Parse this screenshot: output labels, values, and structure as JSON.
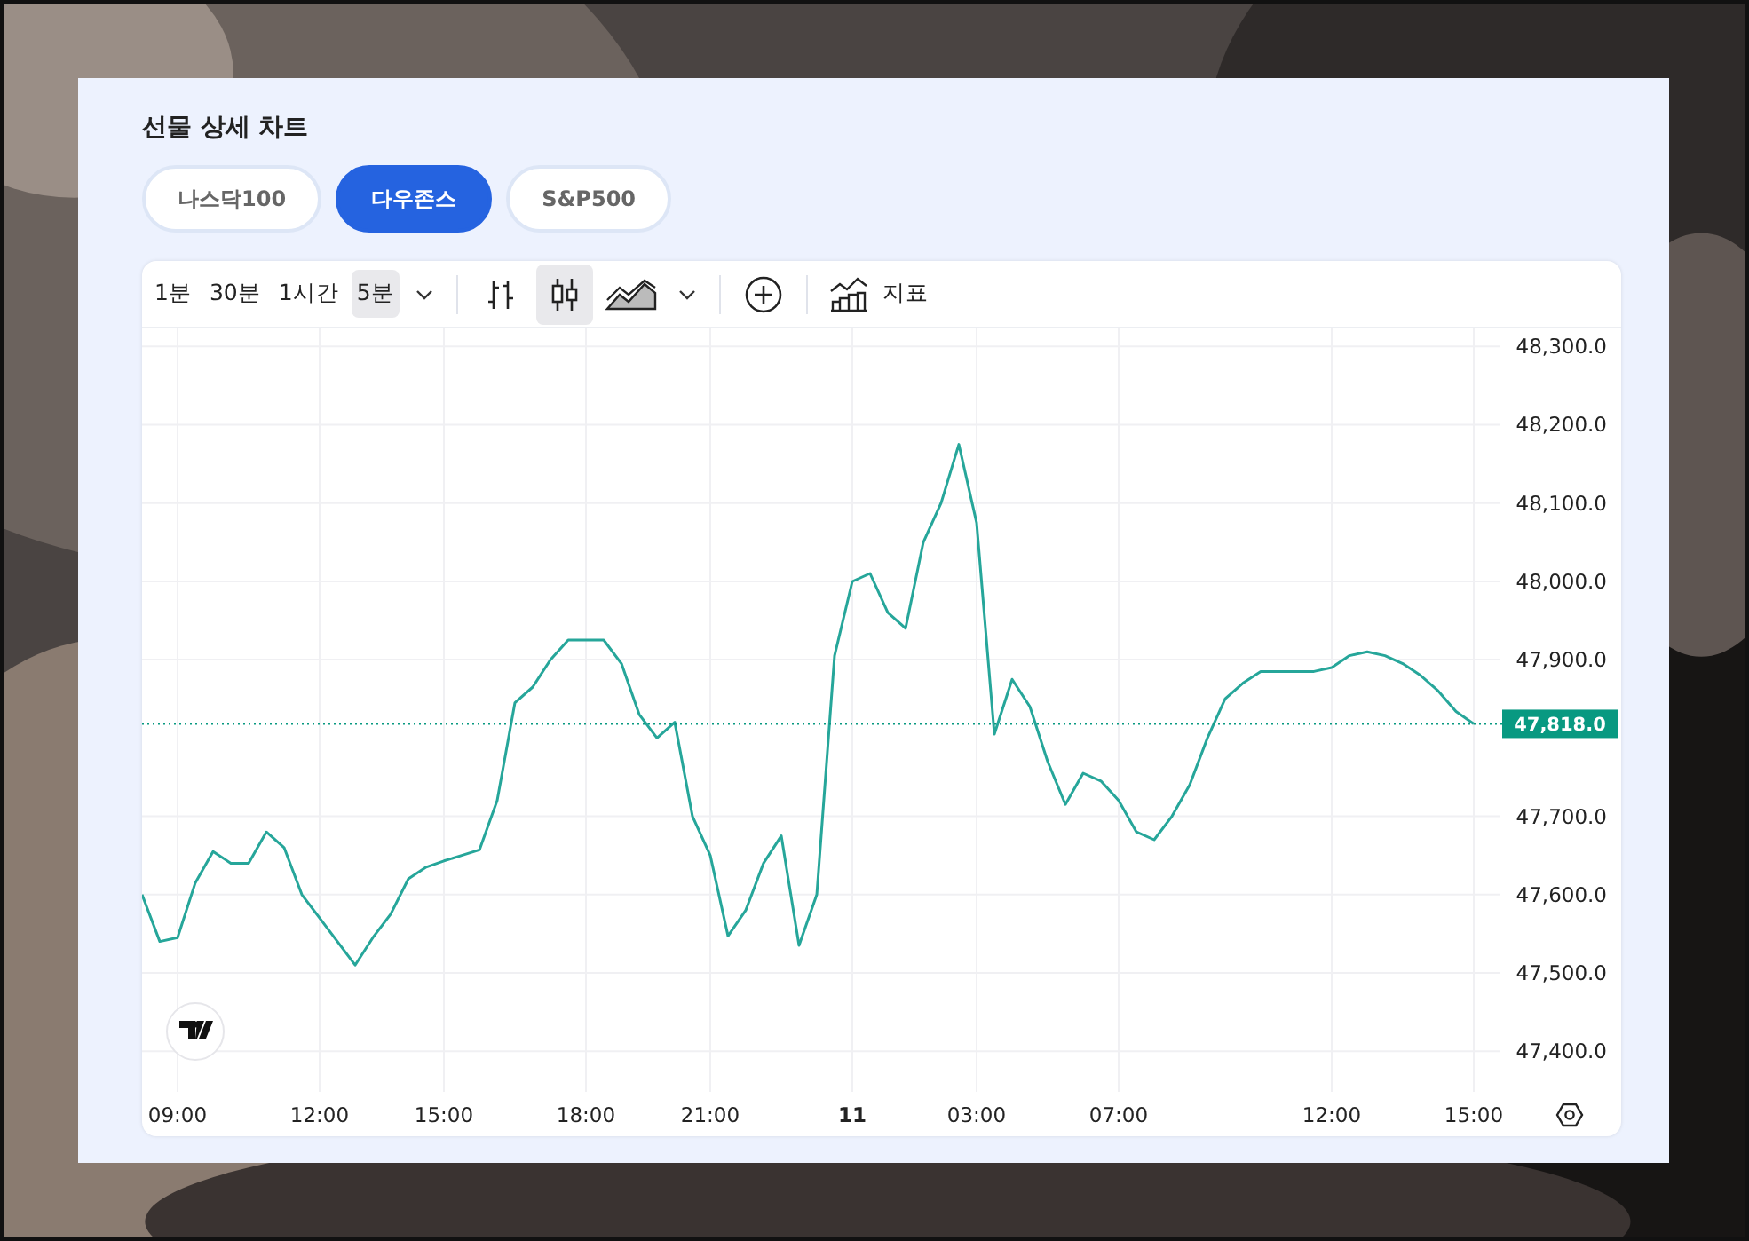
{
  "title": "선물 상세 차트",
  "tabs": [
    {
      "label": "나스닥100",
      "selected": false
    },
    {
      "label": "다우존스",
      "selected": true
    },
    {
      "label": "S&P500",
      "selected": false
    }
  ],
  "toolbar": {
    "intervals": [
      {
        "label": "1분",
        "selected": false
      },
      {
        "label": "30분",
        "selected": false
      },
      {
        "label": "1시간",
        "selected": false
      },
      {
        "label": "5분",
        "selected": true
      }
    ],
    "chart_styles": [
      {
        "kind": "bars",
        "selected": false
      },
      {
        "kind": "candles",
        "selected": true
      },
      {
        "kind": "area",
        "selected": false
      }
    ],
    "indicators_label": "지표"
  },
  "chart_data": {
    "type": "line",
    "categories": [
      null,
      null,
      "09:00",
      null,
      null,
      null,
      null,
      null,
      null,
      null,
      "12:00",
      null,
      null,
      null,
      null,
      null,
      null,
      "15:00",
      null,
      null,
      null,
      null,
      null,
      null,
      null,
      "18:00",
      null,
      null,
      null,
      null,
      null,
      null,
      "21:00",
      null,
      null,
      null,
      null,
      null,
      null,
      null,
      "11",
      null,
      null,
      null,
      null,
      null,
      null,
      "03:00",
      null,
      null,
      null,
      null,
      null,
      null,
      null,
      "07:00",
      null,
      null,
      null,
      null,
      null,
      null,
      null,
      null,
      null,
      null,
      null,
      "12:00",
      null,
      null,
      null,
      null,
      null,
      null,
      null,
      "15:00"
    ],
    "series": [
      {
        "color": "#26a69a",
        "values": [
          47600,
          47540,
          47545,
          47615,
          47655,
          47640,
          47640,
          47680,
          47660,
          47600,
          47570,
          47540,
          47510,
          47545,
          47575,
          47620,
          47635,
          47643,
          47650,
          47657,
          47720,
          47845,
          47865,
          47900,
          47925,
          47925,
          47925,
          47895,
          47830,
          47800,
          47820,
          47700,
          47650,
          47547,
          47580,
          47640,
          47675,
          47535,
          47600,
          47905,
          48000,
          48010,
          47960,
          47940,
          48050,
          48100,
          48175,
          48075,
          47805,
          47875,
          47840,
          47770,
          47715,
          47755,
          47745,
          47720,
          47680,
          47670,
          47700,
          47740,
          47800,
          47850,
          47870,
          47885,
          47885,
          47885,
          47885,
          47890,
          47905,
          47910,
          47905,
          47895,
          47880,
          47860,
          47834,
          47818
        ]
      }
    ],
    "ylim": [
      47348,
      48323
    ],
    "grid": true,
    "ref_lines": [
      {
        "axis": "y",
        "value": 47818,
        "label": "47,818.0",
        "color": "#089981"
      }
    ],
    "yticks": [
      {
        "value": 48300,
        "label": "48,300.0"
      },
      {
        "value": 48200,
        "label": "48,200.0"
      },
      {
        "value": 48100,
        "label": "48,100.0"
      },
      {
        "value": 48000,
        "label": "48,000.0"
      },
      {
        "value": 47900,
        "label": "47,900.0"
      },
      {
        "value": 47700,
        "label": "47,700.0"
      },
      {
        "value": 47600,
        "label": "47,600.0"
      },
      {
        "value": 47500,
        "label": "47,500.0"
      },
      {
        "value": 47400,
        "label": "47,400.0"
      }
    ]
  }
}
